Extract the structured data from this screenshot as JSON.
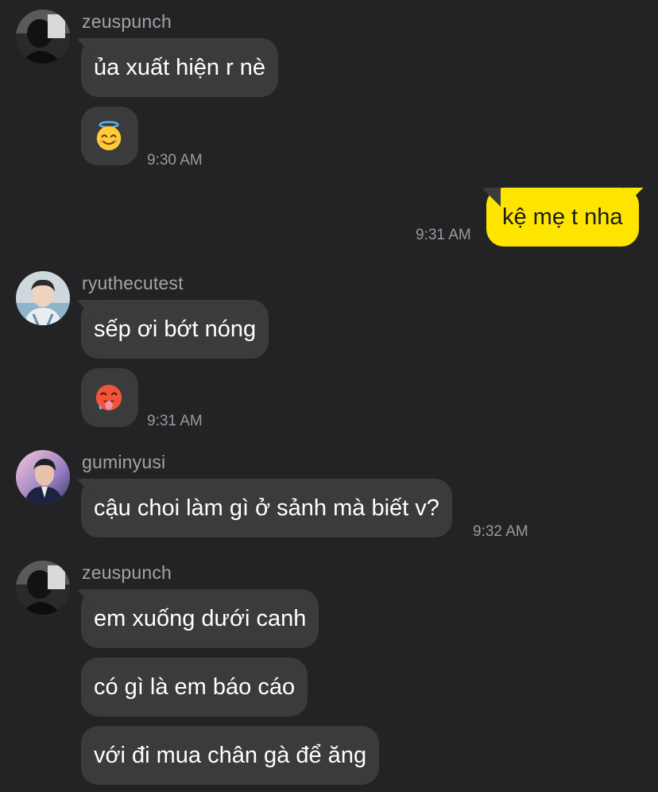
{
  "colors": {
    "background": "#232325",
    "incoming_bubble": "#3b3b3e",
    "outgoing_bubble": "#fee500",
    "username": "#a3a3a7",
    "timestamp": "#9a9a9e"
  },
  "messages": [
    {
      "sender": "zeuspunch",
      "avatar_icon": "user-avatar-icon",
      "bubbles": [
        {
          "type": "text",
          "text": "ủa xuất hiện r nè"
        },
        {
          "type": "emoji",
          "icon": "smiling-face-with-halo-icon",
          "time": "9:30 AM"
        }
      ]
    },
    {
      "sender": "me",
      "bubbles": [
        {
          "type": "text",
          "text": "kệ mẹ t nha",
          "time": "9:31 AM"
        }
      ]
    },
    {
      "sender": "ryuthecutest",
      "avatar_icon": "user-avatar-icon",
      "bubbles": [
        {
          "type": "text",
          "text": "sếp ơi bớt nóng"
        },
        {
          "type": "emoji",
          "icon": "hot-face-icon",
          "time": "9:31 AM"
        }
      ]
    },
    {
      "sender": "guminyusi",
      "avatar_icon": "user-avatar-icon",
      "bubbles": [
        {
          "type": "text",
          "text": "cậu choi làm gì ở sảnh mà biết v?",
          "time": "9:32 AM"
        }
      ]
    },
    {
      "sender": "zeuspunch",
      "avatar_icon": "user-avatar-icon",
      "bubbles": [
        {
          "type": "text",
          "text": "em xuống dưới canh"
        },
        {
          "type": "text",
          "text": "có gì là em báo cáo"
        },
        {
          "type": "text",
          "text": "với đi mua chân gà để ăng"
        }
      ]
    }
  ]
}
